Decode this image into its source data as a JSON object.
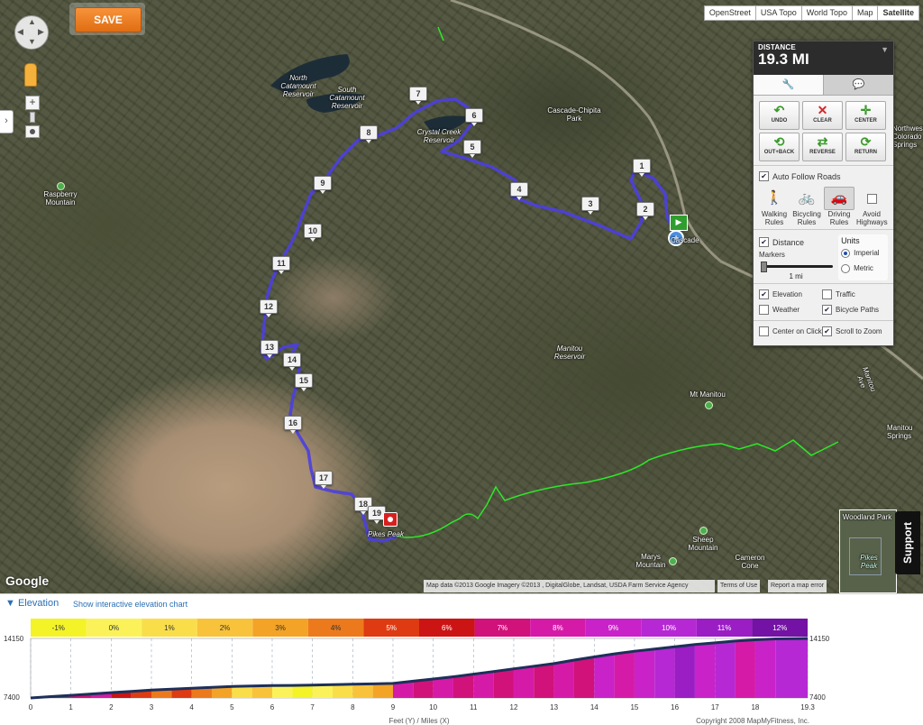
{
  "toolbar": {
    "save_label": "SAVE"
  },
  "map_types": [
    {
      "label": "OpenStreet",
      "active": false
    },
    {
      "label": "USA Topo",
      "active": false
    },
    {
      "label": "World Topo",
      "active": false
    },
    {
      "label": "Map",
      "active": false
    },
    {
      "label": "Satellite",
      "active": true
    }
  ],
  "zoom": {
    "plus": "+",
    "minus": "−"
  },
  "panel": {
    "distance_label": "DISTANCE",
    "distance_value": "19.3 MI",
    "tabs": [
      "wrench-tab",
      "comment-tab"
    ],
    "actions": [
      {
        "label": "UNDO",
        "icon": "↶",
        "color": "#3a9a2a"
      },
      {
        "label": "CLEAR",
        "icon": "✕",
        "color": "#d42a2a"
      },
      {
        "label": "CENTER",
        "icon": "✛",
        "color": "#3a9a2a"
      },
      {
        "label": "OUT+BACK",
        "icon": "⟲",
        "color": "#3a9a2a"
      },
      {
        "label": "REVERSE",
        "icon": "⇄",
        "color": "#3a9a2a"
      },
      {
        "label": "RETURN",
        "icon": "⟳",
        "color": "#3a9a2a"
      }
    ],
    "auto_follow_label": "Auto Follow Roads",
    "rules": [
      {
        "label": "Walking Rules",
        "icon": "🚶",
        "selected": false
      },
      {
        "label": "Bicycling Rules",
        "icon": "🚲",
        "selected": false
      },
      {
        "label": "Driving Rules",
        "icon": "🚗",
        "selected": true
      },
      {
        "label": "Avoid Highways",
        "icon": "",
        "selected": false
      }
    ],
    "distance_label2": "Distance",
    "markers_label": "Markers",
    "marker_interval": "1 mi",
    "units_label": "Units",
    "units": [
      {
        "label": "Imperial",
        "selected": true
      },
      {
        "label": "Metric",
        "selected": false
      }
    ],
    "toggles": [
      {
        "label": "Elevation",
        "checked": true
      },
      {
        "label": "Traffic",
        "checked": false
      },
      {
        "label": "Weather",
        "checked": false
      },
      {
        "label": "Bicycle Paths",
        "checked": true
      },
      {
        "label": "Center on Click",
        "checked": false
      },
      {
        "label": "Scroll to Zoom",
        "checked": true
      }
    ]
  },
  "map_labels": [
    {
      "text": "North Catamount Reservoir"
    },
    {
      "text": "South Catamount Reservoir"
    },
    {
      "text": "Crystal Creek Reservoir"
    },
    {
      "text": "Cascade-Chipita Park"
    },
    {
      "text": "Raspberry Mountain"
    },
    {
      "text": "Manitou Reservoir"
    },
    {
      "text": "Mt Manitou"
    },
    {
      "text": "Northwest Colorado Springs"
    },
    {
      "text": "Manitou Springs"
    },
    {
      "text": "Sheep Mountain"
    },
    {
      "text": "Marys Mountain"
    },
    {
      "text": "Cameron Cone"
    },
    {
      "text": "Pikes Peak"
    },
    {
      "text": "Cascade"
    },
    {
      "text": "Woodland Park"
    },
    {
      "text": "Pikes Peak"
    },
    {
      "text": "Manitou Ave"
    }
  ],
  "route_markers": [
    "1",
    "2",
    "3",
    "4",
    "5",
    "6",
    "7",
    "8",
    "9",
    "10",
    "11",
    "12",
    "13",
    "14",
    "15",
    "16",
    "17",
    "18",
    "19"
  ],
  "attribution": {
    "data": "Map data ©2013 Google Imagery ©2013 , DigitalGlobe, Landsat, USDA Farm Service Agency",
    "terms": "Terms of Use",
    "report": "Report a map error",
    "logo": "Google"
  },
  "support_label": "Support",
  "elevation": {
    "title": "Elevation",
    "link": "Show interactive elevation chart",
    "xlabel": "Feet (Y) / Miles (X)",
    "copyright": "Copyright 2008 MapMyFitness, Inc."
  },
  "chart_data": {
    "type": "area",
    "title": "Elevation",
    "xlabel": "Feet (Y) / Miles (X)",
    "ylabel": "",
    "xlim": [
      0,
      19.3
    ],
    "ylim": [
      7400,
      14150
    ],
    "x_ticks": [
      "0",
      "1",
      "2",
      "3",
      "4",
      "5",
      "6",
      "7",
      "8",
      "9",
      "10",
      "11",
      "12",
      "13",
      "14",
      "15",
      "16",
      "17",
      "18",
      "19.3"
    ],
    "y_ticks": [
      "7400",
      "14150"
    ],
    "grade_legend": [
      {
        "label": "-1%",
        "color": "#f3f328"
      },
      {
        "label": "0%",
        "color": "#fbf25a"
      },
      {
        "label": "1%",
        "color": "#f9de4a"
      },
      {
        "label": "2%",
        "color": "#f8c33a"
      },
      {
        "label": "3%",
        "color": "#f3a326"
      },
      {
        "label": "4%",
        "color": "#ec7a1c"
      },
      {
        "label": "5%",
        "color": "#de3b12"
      },
      {
        "label": "6%",
        "color": "#cc1414"
      },
      {
        "label": "7%",
        "color": "#d0127a"
      },
      {
        "label": "8%",
        "color": "#d61aa8"
      },
      {
        "label": "9%",
        "color": "#c922c8"
      },
      {
        "label": "10%",
        "color": "#b628d4"
      },
      {
        "label": "11%",
        "color": "#9a1ec4"
      },
      {
        "label": "12%",
        "color": "#7312a4"
      }
    ],
    "series": [
      {
        "x": [
          0,
          0.5,
          1,
          1.5,
          2,
          2.5,
          3,
          3.5,
          4,
          4.5,
          5,
          5.5,
          6,
          6.5,
          7,
          7.5,
          8,
          8.5,
          9,
          9.5,
          10,
          10.5,
          11,
          11.5,
          12,
          12.5,
          13,
          13.5,
          14,
          14.5,
          15,
          15.5,
          16,
          16.5,
          17,
          17.5,
          18,
          18.5,
          19.3
        ],
        "y": [
          7400,
          7550,
          7700,
          7850,
          8000,
          8150,
          8300,
          8400,
          8500,
          8600,
          8700,
          8750,
          8800,
          8820,
          8850,
          8900,
          8950,
          9000,
          9050,
          9300,
          9550,
          9800,
          10100,
          10400,
          10700,
          11000,
          11300,
          11700,
          12050,
          12400,
          12700,
          12950,
          13200,
          13450,
          13650,
          13850,
          14000,
          14100,
          14150
        ],
        "grade": [
          9,
          8,
          8,
          9,
          7,
          6,
          5,
          6,
          5,
          4,
          2,
          3,
          1,
          0,
          1,
          2,
          3,
          4,
          9,
          8,
          9,
          8,
          9,
          8,
          9,
          8,
          9,
          8,
          10,
          9,
          10,
          11,
          12,
          10,
          11,
          9,
          10,
          11,
          12
        ]
      }
    ]
  }
}
